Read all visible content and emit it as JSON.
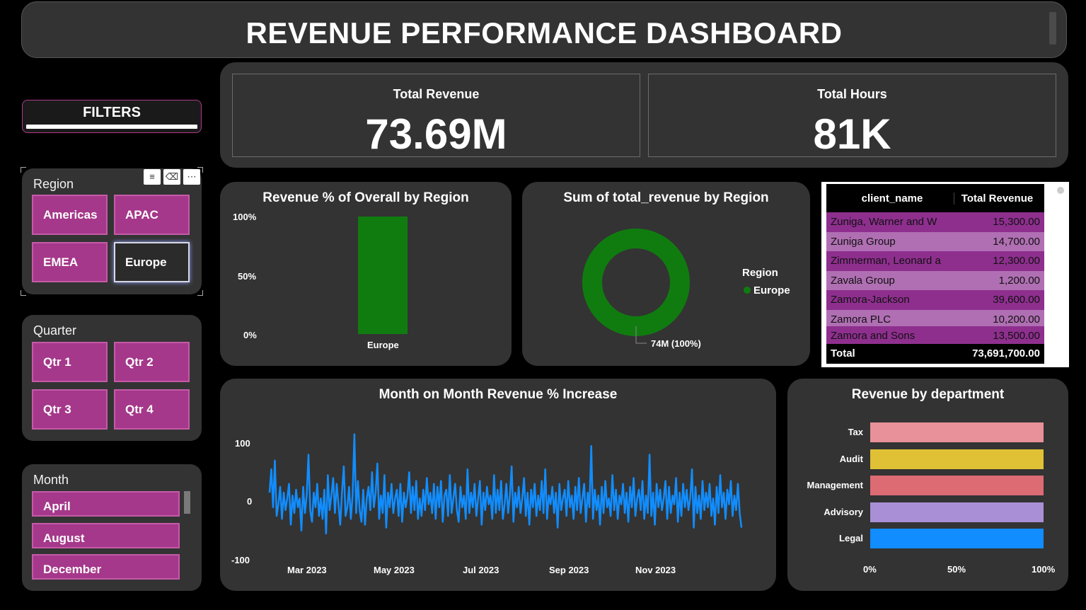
{
  "title": "REVENUE PERFORMANCE DASHBOARD",
  "filters_label": "FILTERS",
  "region_slicer": {
    "title": "Region",
    "items": [
      "Americas",
      "APAC",
      "EMEA",
      "Europe"
    ],
    "selected": "Europe"
  },
  "quarter_slicer": {
    "title": "Quarter",
    "items": [
      "Qtr 1",
      "Qtr 2",
      "Qtr 3",
      "Qtr 4"
    ]
  },
  "month_slicer": {
    "title": "Month",
    "items": [
      "April",
      "August",
      "December"
    ]
  },
  "kpis": [
    {
      "label": "Total Revenue",
      "value": "73.69M"
    },
    {
      "label": "Total Hours",
      "value": "81K"
    }
  ],
  "region_pct_chart": {
    "title": "Revenue % of Overall by Region",
    "y_ticks": [
      "100%",
      "50%",
      "0%"
    ],
    "category": "Europe",
    "color": "#107c10"
  },
  "donut_chart": {
    "title": "Sum of total_revenue by Region",
    "legend_title": "Region",
    "legend_item": "Europe",
    "data_label": "74M (100%)",
    "color": "#107c10"
  },
  "client_table": {
    "headers": [
      "client_name",
      "Total Revenue"
    ],
    "rows": [
      [
        "Zuniga, Warner and W",
        "15,300.00"
      ],
      [
        "Zuniga Group",
        "14,700.00"
      ],
      [
        "Zimmerman, Leonard a",
        "12,300.00"
      ],
      [
        "Zavala Group",
        "1,200.00"
      ],
      [
        "Zamora-Jackson",
        "39,600.00"
      ],
      [
        "Zamora PLC",
        "10,200.00"
      ],
      [
        "Zamora and Sons",
        "13,500.00"
      ]
    ],
    "total_label": "Total",
    "total_value": "73,691,700.00"
  },
  "mom_chart": {
    "title": "Month on Month Revenue % Increase",
    "y_ticks": [
      "100",
      "0",
      "-100"
    ],
    "x_ticks": [
      "Mar 2023",
      "May 2023",
      "Jul 2023",
      "Sep 2023",
      "Nov 2023"
    ],
    "color": "#118dff"
  },
  "chart_data": [
    {
      "type": "bar",
      "title": "Revenue % of Overall by Region",
      "categories": [
        "Europe"
      ],
      "values": [
        100
      ],
      "ylim": [
        0,
        100
      ],
      "y_unit": "%"
    },
    {
      "type": "pie",
      "title": "Sum of total_revenue by Region",
      "categories": [
        "Europe"
      ],
      "values": [
        74
      ],
      "labels": [
        "74M (100%)"
      ],
      "legend_placement": "right"
    },
    {
      "type": "line",
      "title": "Month on Month Revenue % Increase",
      "x_start": "2023-02-01",
      "x_end": "2023-12-31",
      "ylim": [
        -100,
        100
      ],
      "values": [
        15,
        55,
        -10,
        70,
        -25,
        -5,
        25,
        -30,
        15,
        -15,
        5,
        30,
        -40,
        10,
        -20,
        20,
        -10,
        5,
        -50,
        25,
        -20,
        10,
        80,
        -15,
        -35,
        15,
        -10,
        30,
        -25,
        5,
        -30,
        20,
        -55,
        45,
        -15,
        10,
        40,
        -20,
        30,
        -5,
        -40,
        15,
        60,
        -25,
        -10,
        25,
        -30,
        10,
        115,
        -20,
        35,
        -15,
        -35,
        20,
        -40,
        5,
        25,
        -15,
        50,
        -10,
        15,
        65,
        -30,
        10,
        -20,
        45,
        -45,
        15,
        -10,
        30,
        -20,
        5,
        20,
        -25,
        30,
        -35,
        15,
        -10,
        10,
        50,
        -20,
        25,
        -15,
        35,
        -30,
        5,
        -25,
        20,
        -15,
        40,
        -5,
        15,
        -20,
        30,
        -30,
        25,
        -10,
        35,
        -35,
        10,
        20,
        -25,
        45,
        -20,
        5,
        30,
        -15,
        -35,
        25,
        -10,
        10,
        -30,
        55,
        -20,
        15,
        -10,
        30,
        -25,
        5,
        35,
        -40,
        15,
        -15,
        25,
        -5,
        10,
        -30,
        45,
        -20,
        20,
        -15,
        35,
        -30,
        -5,
        30,
        -20,
        10,
        60,
        -35,
        15,
        -10,
        25,
        -20,
        5,
        40,
        -25,
        15,
        -40,
        20,
        -10,
        30,
        -25,
        10,
        -15,
        35,
        -20,
        55,
        -30,
        10,
        -5,
        25,
        -20,
        15,
        -45,
        30,
        -15,
        5,
        20,
        -25,
        35,
        -10,
        10,
        -30,
        25,
        -15,
        40,
        -20,
        5,
        30,
        -35,
        15,
        -10,
        95,
        -30,
        20,
        -15,
        10,
        -40,
        25,
        -20,
        35,
        -10,
        5,
        -25,
        45,
        -15,
        20,
        -30,
        10,
        -5,
        30,
        -20,
        15,
        -35,
        25,
        -10,
        40,
        -25,
        5,
        20,
        -15,
        35,
        -30,
        10,
        -20,
        80,
        -25,
        15,
        -40,
        30,
        -10,
        20,
        -15,
        5,
        35,
        -30,
        25,
        -20,
        10,
        -5,
        40,
        -35,
        15,
        -25,
        30,
        -10,
        20,
        -15,
        5,
        55,
        -45,
        25,
        -20,
        10,
        -30,
        35,
        -15,
        15,
        -10,
        30,
        -25,
        5,
        -40,
        25,
        -20,
        45,
        -10,
        15,
        -30,
        20,
        -5,
        35,
        -25,
        10,
        -15,
        30,
        -20,
        -45
      ]
    },
    {
      "type": "bar",
      "orientation": "horizontal",
      "title": "Revenue by department",
      "categories": [
        "Tax",
        "Audit",
        "Management",
        "Advisory",
        "Legal"
      ],
      "values": [
        100,
        100,
        100,
        100,
        100
      ],
      "colors": [
        "#e8919a",
        "#e0c135",
        "#dd6b73",
        "#a98fd6",
        "#118dff"
      ],
      "x_ticks": [
        "0%",
        "50%",
        "100%"
      ],
      "xlim": [
        0,
        100
      ]
    }
  ]
}
